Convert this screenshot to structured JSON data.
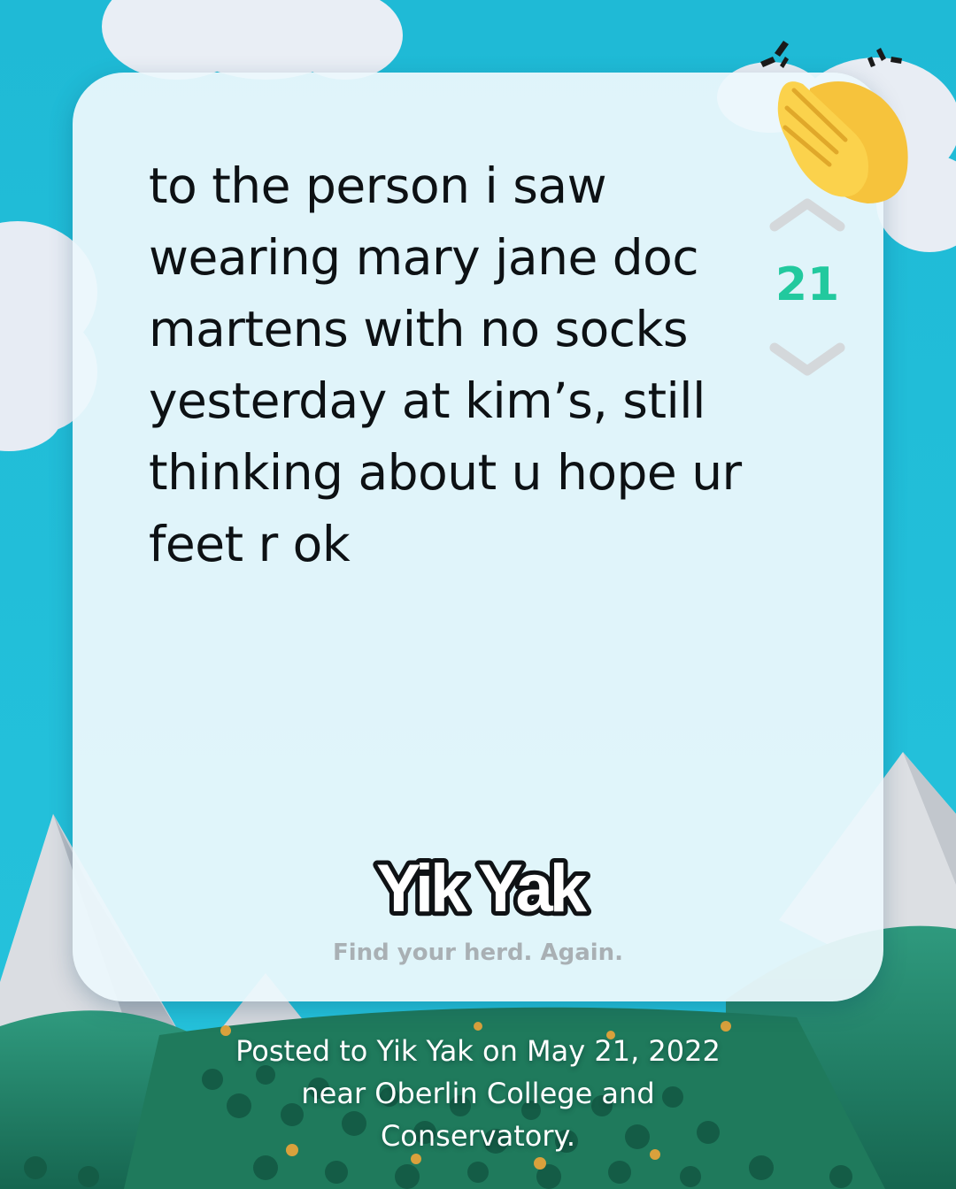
{
  "post": {
    "text": "to the person i saw\nwearing mary jane doc\nmartens with no socks\nyesterday at kim’s, still\nthinking about u hope ur\nfeet r ok",
    "vote_count": "21"
  },
  "brand": {
    "logo_text": "Yik Yak",
    "tagline": "Find your herd. Again."
  },
  "caption": {
    "text": "Posted to Yik Yak on May 21, 2022\nnear Oberlin College and\nConservatory."
  },
  "icons": {
    "upvote": "chevron-up-icon",
    "downvote": "chevron-down-icon",
    "reaction": "clapping-hands-icon"
  },
  "colors": {
    "sky": "#20bcd8",
    "card": "#ecf8fc",
    "vote_count": "#22c99e",
    "vote_arrow": "#d4d8db",
    "tagline": "#a9b0b4",
    "text": "#0d1114"
  }
}
